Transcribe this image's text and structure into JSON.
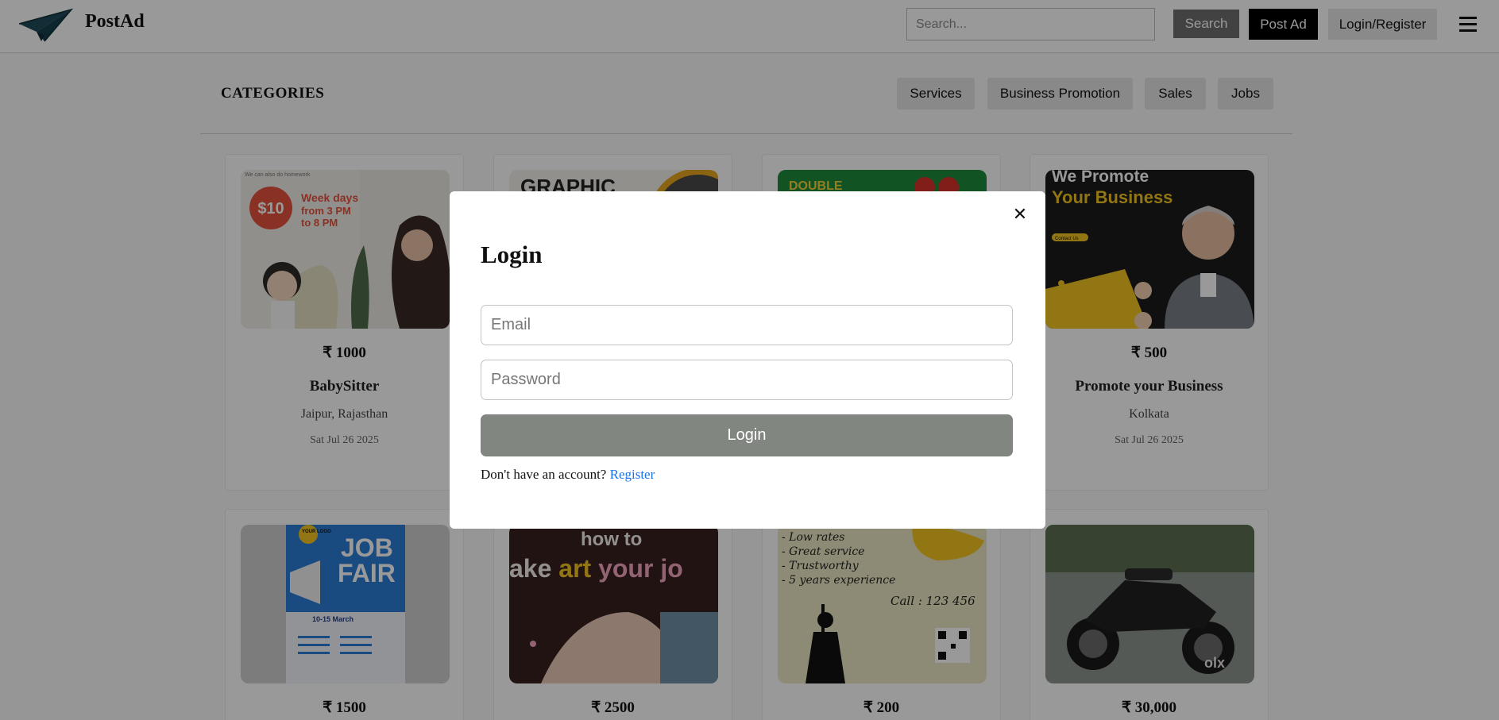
{
  "header": {
    "brand": "PostAd",
    "search_placeholder": "Search...",
    "search_button": "Search",
    "post_ad_button": "Post Ad",
    "login_register_button": "Login/Register"
  },
  "categories": {
    "title": "CATEGORIES",
    "items": [
      "Services",
      "Business Promotion",
      "Sales",
      "Jobs"
    ]
  },
  "cards": [
    {
      "price": "₹ 1000",
      "title": "BabySitter",
      "location": "Jaipur, Rajasthan",
      "date": "Sat Jul 26 2025"
    },
    {
      "price": "",
      "title": "",
      "location": "",
      "date": ""
    },
    {
      "price": "",
      "title": "",
      "location": "",
      "date": ""
    },
    {
      "price": "₹ 500",
      "title": "Promote your Business",
      "location": "Kolkata",
      "date": "Sat Jul 26 2025"
    },
    {
      "price": "₹ 1500"
    },
    {
      "price": "₹ 2500"
    },
    {
      "price": "₹ 200"
    },
    {
      "price": "₹ 30,000"
    }
  ],
  "images": {
    "babysitter": {
      "line1": "$10",
      "line2": "Week days",
      "line3": "from 3 PM",
      "line4": "to 8 PM",
      "top": "We can also do homework"
    },
    "graphic": {
      "text": "GRAPHIC"
    },
    "double": {
      "text": "DOUBLE"
    },
    "promote": {
      "line1": "We Promote",
      "line2": "Your Business",
      "contact": "Contact Us"
    },
    "jobfair": {
      "logo": "YOUR LOGO",
      "line1": "JOB",
      "line2": "FAIR",
      "dates": "10-15 March"
    },
    "art": {
      "line1": "how to",
      "line2a": "ake ",
      "line2b": "art",
      "line2c": " your jo"
    },
    "cleaning": {
      "line1": "- Low rates",
      "line2": "- Great service",
      "line3": "- Trustworthy",
      "line4": "- 5 years experience",
      "call": "Call : 123 456"
    },
    "bike": {
      "watermark": "olx"
    }
  },
  "modal": {
    "title": "Login",
    "close_glyph": "✕",
    "email_placeholder": "Email",
    "password_placeholder": "Password",
    "submit": "Login",
    "footer_text": "Don't have an account?",
    "register_link": "Register"
  },
  "icons": [
    "paper-plane-logo-icon",
    "hamburger-menu-icon",
    "close-icon"
  ],
  "colors": {
    "primary_dark": "#000000",
    "accent_link": "#1a73e8",
    "login_button": "#818681",
    "logo_teal": "#173f4a"
  }
}
